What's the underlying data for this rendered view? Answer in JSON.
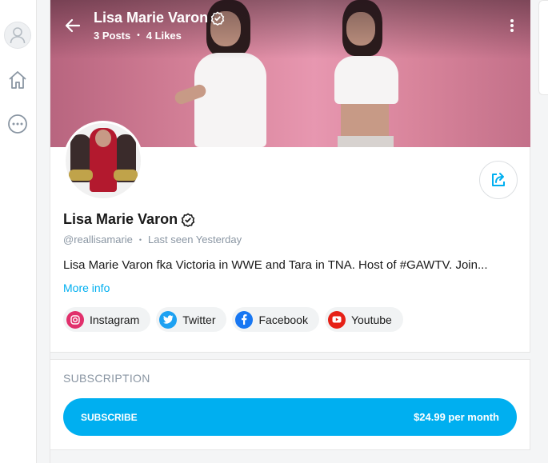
{
  "header": {
    "name": "Lisa Marie Varon",
    "posts": "3 Posts",
    "likes": "4 Likes",
    "separator": "•"
  },
  "profile": {
    "name": "Lisa Marie Varon",
    "handle": "@reallisamarie",
    "meta_separator": "•",
    "last_seen": "Last seen Yesterday",
    "bio": "Lisa Marie Varon fka Victoria in WWE and Tara in TNA. Host of #GAWTV. Join...",
    "more_info": "More info"
  },
  "socials": [
    {
      "label": "Instagram",
      "icon": "instagram-icon",
      "color": "#e1306c"
    },
    {
      "label": "Twitter",
      "icon": "twitter-icon",
      "color": "#1da1f2"
    },
    {
      "label": "Facebook",
      "icon": "facebook-icon",
      "color": "#1877f2"
    },
    {
      "label": "Youtube",
      "icon": "youtube-icon",
      "color": "#e62117"
    }
  ],
  "subscription": {
    "section_title": "SUBSCRIPTION",
    "button_label": "SUBSCRIBE",
    "price": "$24.99 per month"
  },
  "colors": {
    "accent": "#00aff0",
    "muted_text": "#8a96a3"
  }
}
